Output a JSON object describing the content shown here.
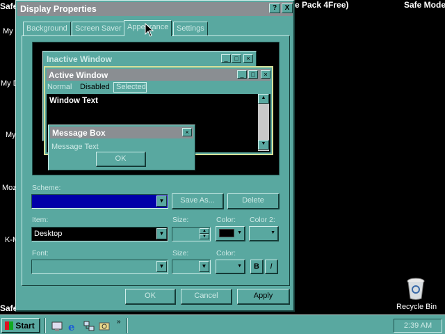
{
  "desktop": {
    "header_left_text": "Safe",
    "header_mid_text": "e Pack 4Free)",
    "header_right_text": "Safe Mode",
    "footer_left_text": "Safe",
    "icon_labels": [
      "My",
      "My D",
      "My",
      "Moz",
      "K-M"
    ],
    "recycle_bin_label": "Recycle Bin"
  },
  "dialog": {
    "title": "Display Properties",
    "help_label": "?",
    "close_label": "X",
    "tabs": [
      "Background",
      "Screen Saver",
      "Appearance",
      "Settings"
    ],
    "active_tab": "Appearance",
    "preview": {
      "inactive_title": "Inactive Window",
      "active_title": "Active Window",
      "menu_items": [
        "Normal",
        "Disabled",
        "Selected"
      ],
      "window_text": "Window Text",
      "msgbox_title": "Message Box",
      "msgbox_text": "Message Text",
      "msgbox_ok": "OK"
    },
    "scheme_label": "Scheme:",
    "scheme_value": "",
    "save_as_label": "Save As...",
    "delete_label": "Delete",
    "item_label": "Item:",
    "item_value": "Desktop",
    "size_label_1": "Size:",
    "color_label": "Color:",
    "color2_label": "Color 2:",
    "font_label": "Font:",
    "size_label_2": "Size:",
    "color_label_2": "Color:",
    "bold_label": "B",
    "italic_label": "I",
    "ok_label": "OK",
    "cancel_label": "Cancel",
    "apply_label": "Apply",
    "selected_color": "#000000"
  },
  "taskbar": {
    "start_label": "Start",
    "clock": "2:39 AM",
    "chevron": "»"
  },
  "colors": {
    "face": "#59a8a0",
    "scheme_fill": "#0000a8",
    "titlebar": "#8a8e92",
    "active_title_bg": "#8a8e92"
  }
}
